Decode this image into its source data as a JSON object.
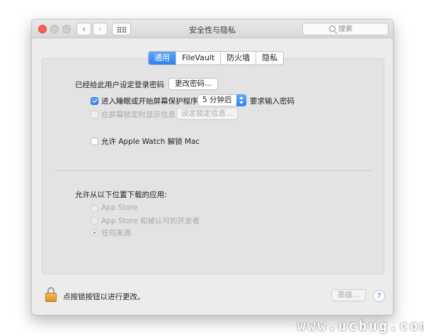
{
  "window": {
    "title": "安全性与隐私",
    "nav": {
      "back_icon": "chevron-left-icon",
      "forward_icon": "chevron-right-icon",
      "grid_icon": "show-all-grid-icon"
    },
    "search": {
      "placeholder": "搜索",
      "icon": "search-icon"
    }
  },
  "tabs": [
    {
      "label": "通用",
      "active": true
    },
    {
      "label": "FileVault",
      "active": false
    },
    {
      "label": "防火墙",
      "active": false
    },
    {
      "label": "隐私",
      "active": false
    }
  ],
  "general": {
    "login_password_label": "已经给此用户设定登录密码",
    "change_password_button": "更改密码...",
    "require_password": {
      "checked": true,
      "label_before": "进入睡眠或开始屏幕保护程序",
      "delay_value": "5 分钟后",
      "label_after": "要求输入密码"
    },
    "show_message": {
      "checked": false,
      "enabled": false,
      "label": "在屏幕锁定时显示信息",
      "button": "设定锁定信息..."
    },
    "apple_watch": {
      "checked": false,
      "label": "允许 Apple Watch 解锁 Mac"
    }
  },
  "downloads": {
    "heading": "允许从以下位置下载的应用:",
    "options": [
      {
        "label": "App Store",
        "selected": false
      },
      {
        "label": "App Store 和被认可的开发者",
        "selected": false
      },
      {
        "label": "任何来源",
        "selected": true
      }
    ]
  },
  "footer": {
    "lock_icon": "padlock-icon",
    "lock_text": "点按锁按钮以进行更改。",
    "advanced_button": "高级...",
    "help_label": "?"
  },
  "watermark": "www.ucbug.com",
  "colors": {
    "accent": "#2e7ff2",
    "close": "#fc5e57",
    "lock": "#e0912a"
  }
}
